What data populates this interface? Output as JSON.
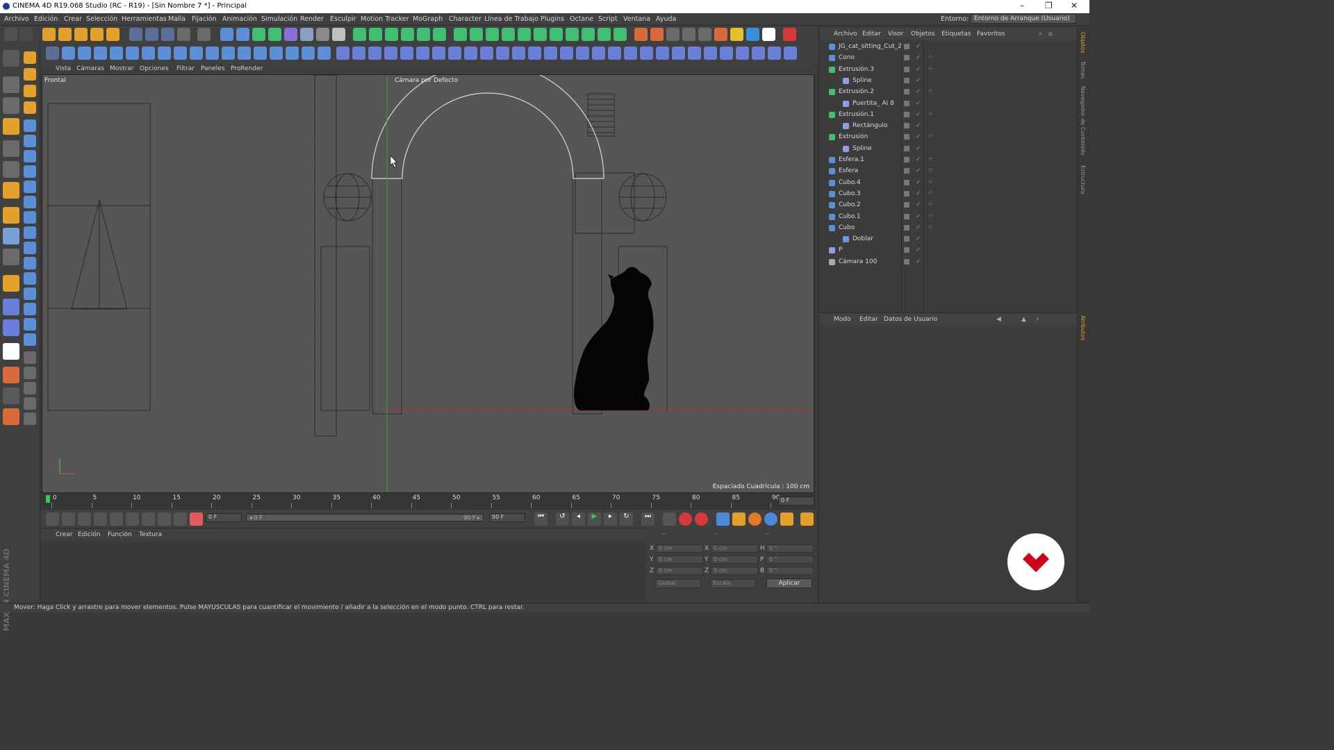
{
  "window": {
    "title": "CINEMA 4D R19.068 Studio (RC - R19) - [Sin Nombre 7 *] - Principal",
    "minimize": "–",
    "maximize": "❐",
    "close": "✕"
  },
  "menubar": {
    "items": [
      "Archivo",
      "Edición",
      "Crear",
      "Selección",
      "Herramientas",
      "Malla",
      "Fijación",
      "Animación",
      "Simulación",
      "Render",
      "Esculpir",
      "Motion Tracker",
      "MoGraph",
      "Character",
      "Línea de Trabajo",
      "Plugins",
      "Octane",
      "Script",
      "Ventana",
      "Ayuda"
    ],
    "entorno_label": "Entorno:",
    "entorno_value": "Entorno de Arranque (Usuario)"
  },
  "viewport": {
    "menu": [
      "Vista",
      "Cámaras",
      "Mostrar",
      "Opciones",
      "Filtrar",
      "Paneles",
      "ProRender"
    ],
    "view_name": "Frontal",
    "camera": "Cámara por Defecto",
    "grid_spacing": "Espaciado Cuadrícula : 100 cm"
  },
  "timeline": {
    "ticks": [
      "0",
      "5",
      "10",
      "15",
      "20",
      "25",
      "30",
      "35",
      "40",
      "45",
      "50",
      "55",
      "60",
      "65",
      "70",
      "75",
      "80",
      "85",
      "90"
    ],
    "current_frame": "0 F",
    "start_field": "0 F",
    "range_start": "◂ 0 F",
    "range_end": "90 F ▸",
    "end_field": "90 F"
  },
  "material_panel": {
    "menu": [
      "Crear",
      "Edición",
      "Función",
      "Textura"
    ]
  },
  "coord_panel": {
    "header_dashes": [
      "--",
      "--",
      "--"
    ],
    "rows": [
      {
        "a": "X",
        "av": "0 cm",
        "b": "X",
        "bv": "0 cm",
        "c": "H",
        "cv": "0 °"
      },
      {
        "a": "Y",
        "av": "0 cm",
        "b": "Y",
        "bv": "0 cm",
        "c": "P",
        "cv": "0 °"
      },
      {
        "a": "Z",
        "av": "0 cm",
        "b": "Z",
        "bv": "0 cm",
        "c": "B",
        "cv": "0 °"
      }
    ],
    "mode1": "Global",
    "mode2": "Escala",
    "apply": "Aplicar"
  },
  "object_manager": {
    "menu": [
      "Archivo",
      "Editar",
      "Visor",
      "Objetos",
      "Etiquetas",
      "Favoritos"
    ],
    "objects": [
      {
        "name": "JG_cat_sitting_Cut_2",
        "indent": 0,
        "icon": "#5a8fd8",
        "tag": false
      },
      {
        "name": "Cono",
        "indent": 0,
        "icon": "#5a8fd8",
        "tag": true
      },
      {
        "name": "Extrusión.3",
        "indent": 0,
        "icon": "#3fbf6f",
        "tag": true
      },
      {
        "name": "Spline",
        "indent": 1,
        "icon": "#8aa0e0",
        "tag": false
      },
      {
        "name": "Extrusión.2",
        "indent": 0,
        "icon": "#3fbf6f",
        "tag": true
      },
      {
        "name": "Puertita_ Ai 8",
        "indent": 1,
        "icon": "#8aa0e0",
        "tag": false
      },
      {
        "name": "Extrusión.1",
        "indent": 0,
        "icon": "#3fbf6f",
        "tag": true
      },
      {
        "name": "Rectángulo",
        "indent": 1,
        "icon": "#8aa0e0",
        "tag": false
      },
      {
        "name": "Extrusión",
        "indent": 0,
        "icon": "#3fbf6f",
        "tag": true
      },
      {
        "name": "Spline",
        "indent": 1,
        "icon": "#8aa0e0",
        "tag": false
      },
      {
        "name": "Esfera.1",
        "indent": 0,
        "icon": "#5a8fd8",
        "tag": true
      },
      {
        "name": "Esfera",
        "indent": 0,
        "icon": "#5a8fd8",
        "tag": true
      },
      {
        "name": "Cubo.4",
        "indent": 0,
        "icon": "#5a8fd8",
        "tag": true
      },
      {
        "name": "Cubo.3",
        "indent": 0,
        "icon": "#5a8fd8",
        "tag": true
      },
      {
        "name": "Cubo.2",
        "indent": 0,
        "icon": "#5a8fd8",
        "tag": true
      },
      {
        "name": "Cubo.1",
        "indent": 0,
        "icon": "#5a8fd8",
        "tag": true
      },
      {
        "name": "Cubo",
        "indent": 0,
        "icon": "#5a8fd8",
        "tag": true
      },
      {
        "name": "Doblar",
        "indent": 1,
        "icon": "#6a9ae0",
        "tag": false
      },
      {
        "name": "P",
        "indent": 0,
        "icon": "#8aa0e0",
        "tag": false
      },
      {
        "name": "Cámara 100",
        "indent": 0,
        "icon": "#aaaaaa",
        "tag": false
      }
    ]
  },
  "attributes": {
    "menu": [
      "Modo",
      "Editar",
      "Datos de Usuario"
    ]
  },
  "right_tabs": [
    "Objetos",
    "Tomas",
    "Navegador de Contenido",
    "Estructura",
    "Atributos"
  ],
  "status": "Mover: Haga Click y arrastre para mover elementos. Pulse MAYUSCULAS para cuantificar el movimiento / añadir a la selección en el modo punto. CTRL para restar.",
  "brand": "MAXON CINEMA 4D",
  "colors": {
    "accent": "#d0021b",
    "selection_green": "#4fc24f"
  }
}
